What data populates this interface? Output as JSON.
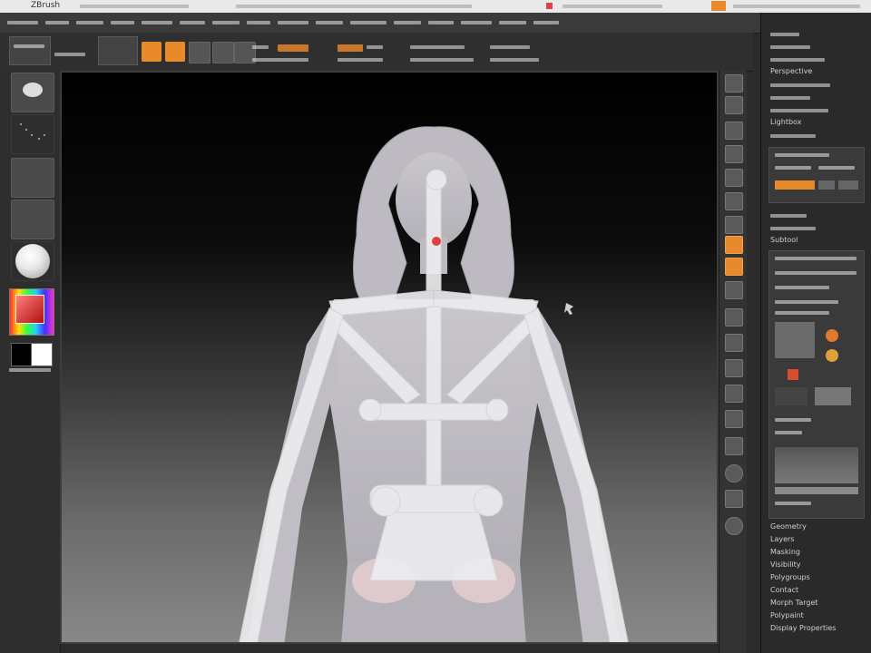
{
  "window": {
    "title": "ZBrush"
  },
  "tray": {
    "labels": [
      "Perspective",
      "Lightbox",
      "Subtool",
      "Geometry",
      "Layers",
      "Masking",
      "Visibility",
      "Polygroups",
      "Contact",
      "Morph Target",
      "Polypaint",
      "Display Properties"
    ]
  },
  "colors": {
    "accent_orange": "#e8892c",
    "ui_dark": "#2b2b2b",
    "skeleton_white": "#e6e6e6",
    "model_grey": "#b7b7bd",
    "joint_red": "#e04040"
  },
  "icons": {
    "brush": "brush-icon",
    "stroke": "stroke-icon",
    "alpha": "alpha-icon",
    "texture": "texture-icon",
    "material": "material-sphere-icon",
    "color_picker": "color-picker-icon",
    "cursor": "cursor-icon"
  }
}
